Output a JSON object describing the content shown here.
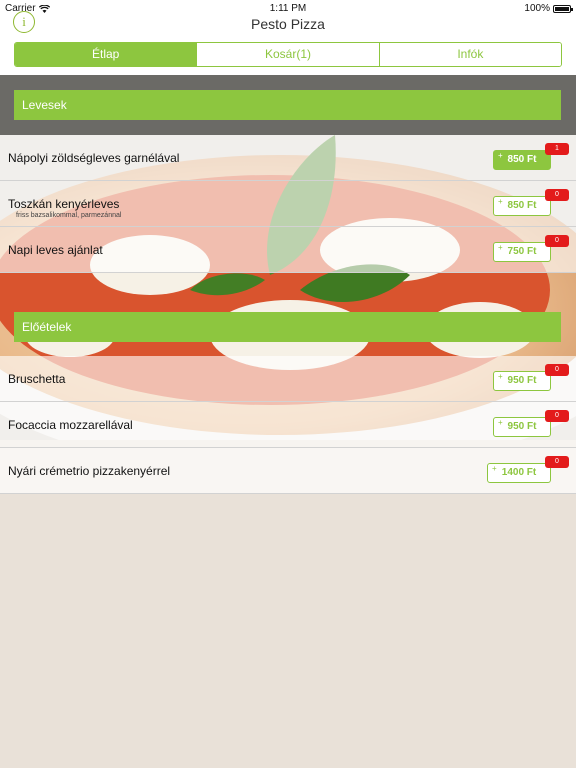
{
  "status_bar": {
    "carrier": "Carrier",
    "time": "1:11 PM",
    "battery": "100%"
  },
  "nav": {
    "title": "Pesto Pizza",
    "info_icon_label": "i"
  },
  "tabs": [
    {
      "label": "Étlap",
      "active": true
    },
    {
      "label": "Kosár(1)",
      "active": false
    },
    {
      "label": "Infók",
      "active": false
    }
  ],
  "sections": [
    {
      "title": "Levesek",
      "items": [
        {
          "name": "Nápolyi zöldségleves garnélával",
          "subtitle": "",
          "price": "850 Ft",
          "count": "1",
          "plus": "+"
        },
        {
          "name": "Toszkán kenyérleves",
          "subtitle": "friss bazsalikommal, parmezánnal",
          "price": "850 Ft",
          "count": "0",
          "plus": "+"
        },
        {
          "name": "Napi leves ajánlat",
          "subtitle": "",
          "price": "750 Ft",
          "count": "0",
          "plus": "+"
        }
      ]
    },
    {
      "title": "Előételek",
      "items": [
        {
          "name": "Bruschetta",
          "subtitle": "",
          "price": "950 Ft",
          "count": "0",
          "plus": "+"
        },
        {
          "name": "Focaccia mozzarellával",
          "subtitle": "",
          "price": "950 Ft",
          "count": "0",
          "plus": "+"
        },
        {
          "name": "Nyári crémetrio pizzakenyérrel",
          "subtitle": "",
          "price": "1400 Ft",
          "count": "0",
          "plus": "+"
        }
      ]
    }
  ],
  "colors": {
    "accent": "#8dc63f",
    "badge": "#e31b1b",
    "background": "#e9e1d8"
  }
}
